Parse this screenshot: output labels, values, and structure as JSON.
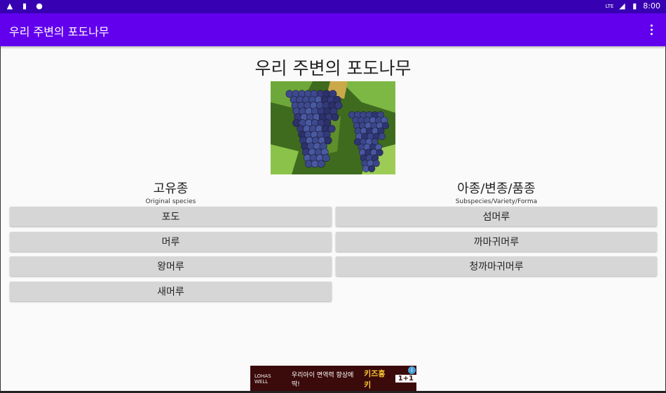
{
  "statusbar": {
    "left_icons": [
      "warning-icon",
      "sdcard-icon",
      "android-icon"
    ],
    "signal_label": "LTE",
    "time": "8:00"
  },
  "appbar": {
    "title": "우리 주변의 포도나무",
    "menu_icon": "more-vert-icon"
  },
  "main": {
    "title": "우리 주변의 포도나무",
    "image_description": "grapes-photo",
    "left_column": {
      "heading": "고유종",
      "subheading": "Original species",
      "buttons": [
        "포도",
        "머루",
        "왕머루",
        "새머루"
      ]
    },
    "right_column": {
      "heading": "아종/변종/품종",
      "subheading": "Subspecies/Variety/Forma",
      "buttons": [
        "섬머루",
        "까마귀머루",
        "청까마귀머루"
      ]
    }
  },
  "ad": {
    "logo": "LOHAS WELL",
    "text": "우리아이 면역력 향상에 딱!",
    "highlight": "키즈홍키",
    "badge": "1+1",
    "info": "i"
  },
  "colors": {
    "statusbar": "#3700b3",
    "appbar": "#6200ee",
    "button": "#d6d6d6",
    "background": "#fafafa"
  }
}
